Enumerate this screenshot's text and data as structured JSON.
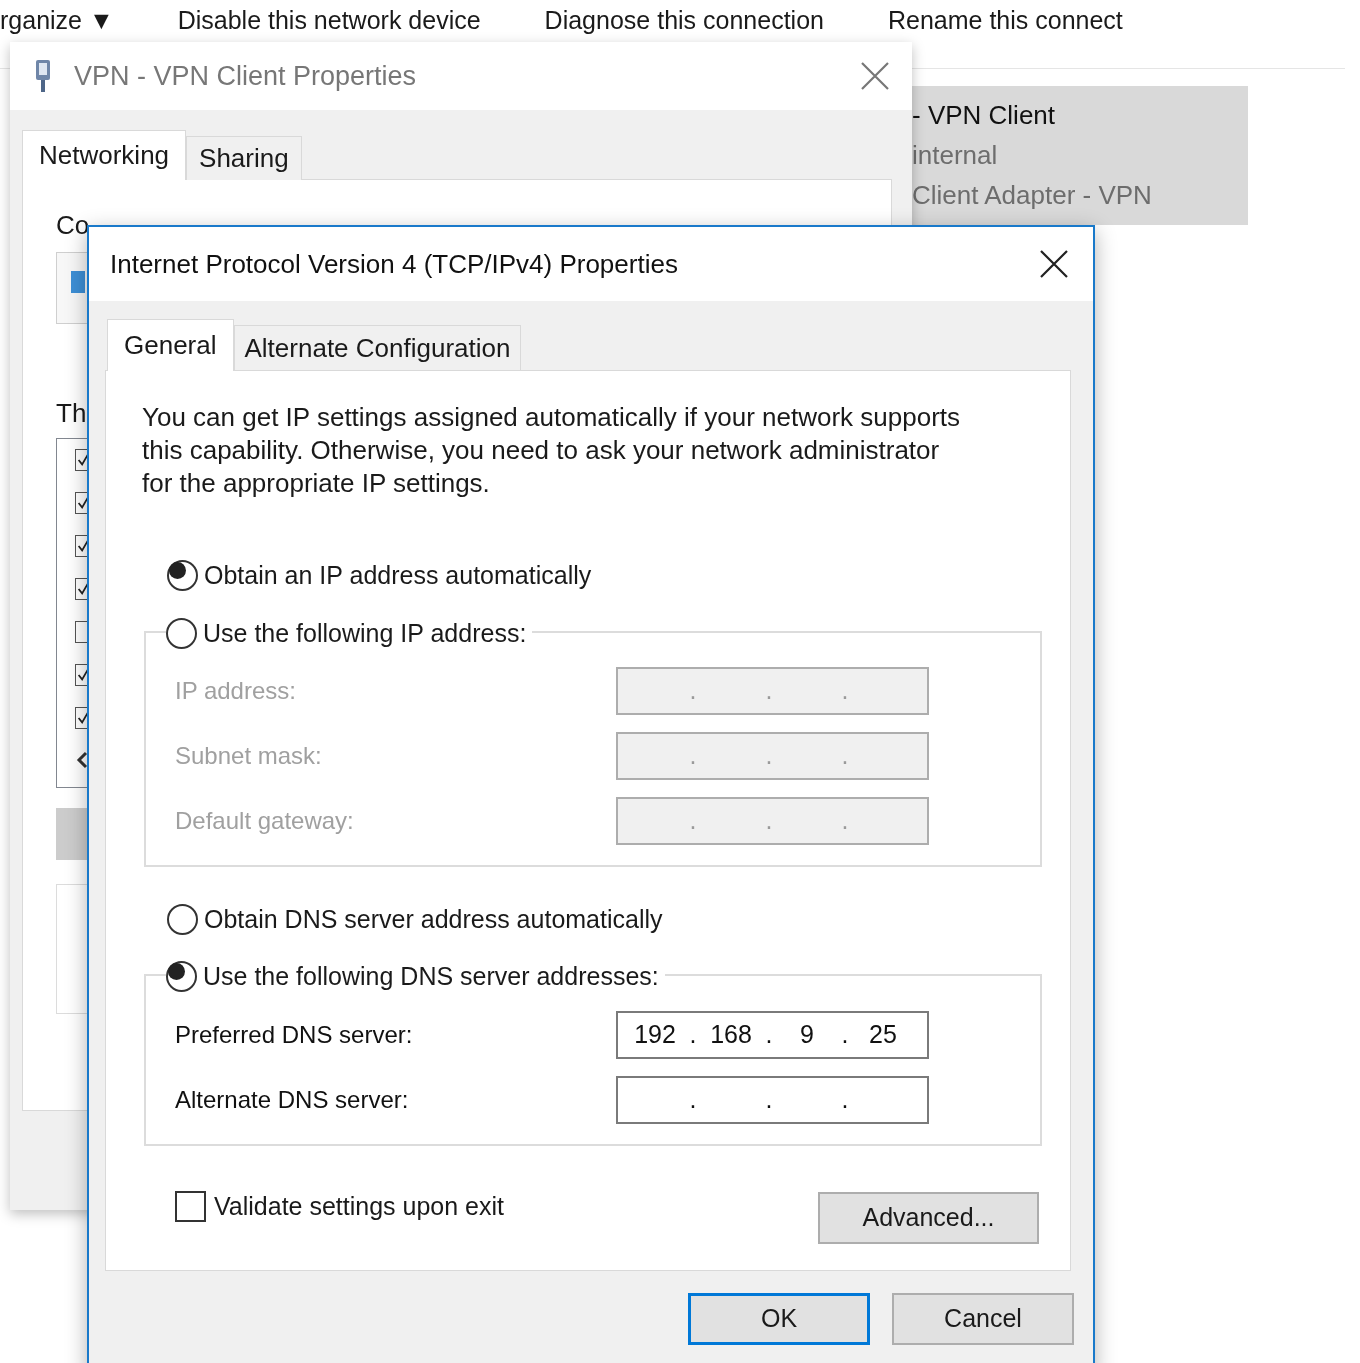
{
  "background_toolbar": {
    "items": [
      "rganize ▼",
      "Disable this network device",
      "Diagnose this connection",
      "Rename this connect"
    ]
  },
  "background_window": {
    "title": "VPN - VPN Client Properties",
    "tabs": [
      {
        "label": "Networking",
        "selected": true
      },
      {
        "label": "Sharing",
        "selected": false
      }
    ],
    "connect_label": "Co",
    "components_label": "Th",
    "components": [
      {
        "checked": true
      },
      {
        "checked": true
      },
      {
        "checked": true
      },
      {
        "checked": true
      },
      {
        "checked": false
      },
      {
        "checked": true
      },
      {
        "checked": true
      }
    ]
  },
  "connection_card": {
    "lines": [
      "- VPN Client",
      "internal",
      "Client Adapter - VPN"
    ]
  },
  "dialog": {
    "title": "Internet Protocol Version 4 (TCP/IPv4) Properties",
    "tabs": [
      {
        "label": "General",
        "selected": true
      },
      {
        "label": "Alternate Configuration",
        "selected": false
      }
    ],
    "description": "You can get IP settings assigned automatically if your network supports this capability. Otherwise, you need to ask your network administrator for the appropriate IP settings.",
    "ip_options": [
      {
        "label": "Obtain an IP address automatically",
        "selected": true
      },
      {
        "label": "Use the following IP address:",
        "selected": false
      }
    ],
    "ip_fields": [
      {
        "label": "IP address:",
        "disabled": true,
        "separators": [
          ".",
          ".",
          "."
        ]
      },
      {
        "label": "Subnet mask:",
        "disabled": true,
        "separators": [
          ".",
          ".",
          "."
        ]
      },
      {
        "label": "Default gateway:",
        "disabled": true,
        "separators": [
          ".",
          ".",
          "."
        ]
      }
    ],
    "dns_options": [
      {
        "label": "Obtain DNS server address automatically",
        "selected": false
      },
      {
        "label": "Use the following DNS server addresses:",
        "selected": true
      }
    ],
    "dns_fields": [
      {
        "label": "Preferred DNS server:",
        "disabled": false,
        "octets": [
          "192",
          "168",
          "9",
          "25"
        ],
        "separators": [
          ".",
          ".",
          "."
        ]
      },
      {
        "label": "Alternate DNS server:",
        "disabled": false,
        "separators": [
          ".",
          ".",
          "."
        ]
      }
    ],
    "validate": {
      "label": "Validate settings upon exit",
      "checked": false
    },
    "advanced_button": "Advanced...",
    "buttons": [
      {
        "label": "OK",
        "default": true
      },
      {
        "label": "Cancel",
        "default": false
      }
    ]
  }
}
